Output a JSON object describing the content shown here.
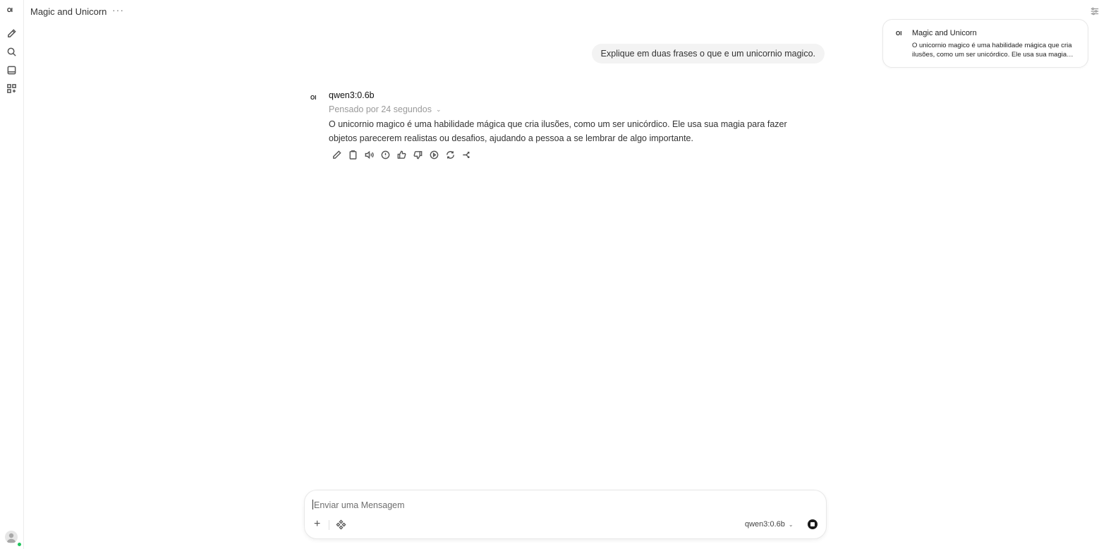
{
  "app": {
    "logo_text": "OI"
  },
  "header": {
    "title": "Magic and Unicorn",
    "more": "···"
  },
  "sidebar": {
    "icons": [
      "pencil-icon",
      "search-icon",
      "notebook-icon",
      "apps-grid-icon"
    ]
  },
  "notification": {
    "logo_text": "OI",
    "title": "Magic and Unicorn",
    "body": "O unicornio magico é uma habilidade mágica que cria ilusões, como um ser unicórdico. Ele usa sua magia para fazer objetos parecerem realistas ou desafios, ajudando a pessoa a se lembrar de algo importante."
  },
  "chat": {
    "user_message": "Explique em duas frases o que e um unicornio magico.",
    "assistant": {
      "avatar_text": "OI",
      "model": "qwen3:0.6b",
      "thinking": "Pensado por 24 segundos",
      "answer": "O unicornio magico é uma habilidade mágica que cria ilusões, como um ser unicórdico. Ele usa sua magia para fazer objetos parecerem realistas ou desafios, ajudando a pessoa a se lembrar de algo importante.",
      "actions": [
        "edit-icon",
        "copy-icon",
        "speaker-icon",
        "info-icon",
        "thumbs-up-icon",
        "thumbs-down-icon",
        "play-icon",
        "regenerate-icon",
        "branch-icon"
      ]
    }
  },
  "composer": {
    "placeholder": "Enviar uma Mensagem",
    "value": "",
    "plus": "+",
    "model": "qwen3:0.6b"
  }
}
